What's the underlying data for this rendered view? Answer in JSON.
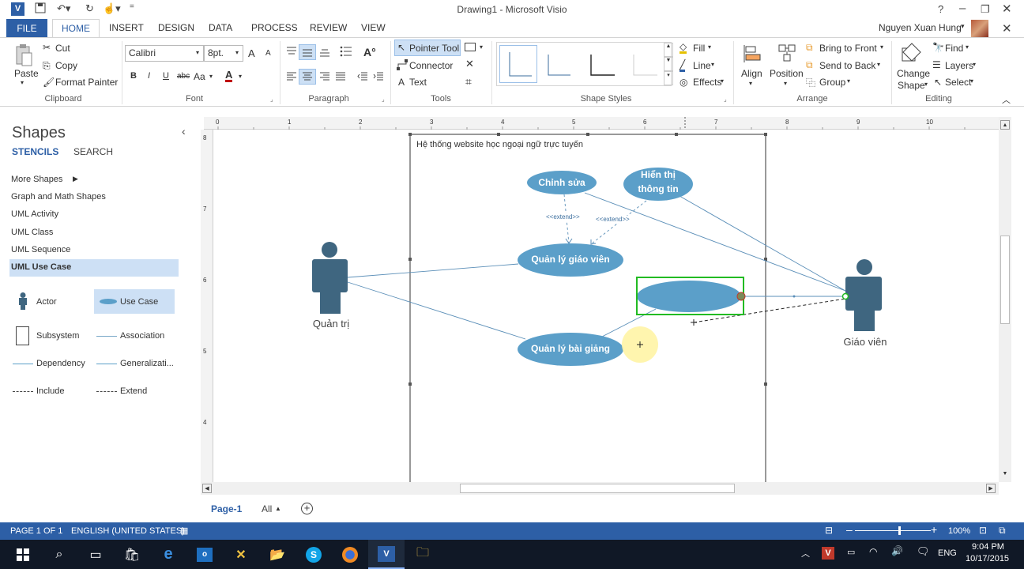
{
  "app": {
    "title": "Drawing1 - Microsoft Visio",
    "user": "Nguyen Xuan Hung",
    "help": "?",
    "logo": "V"
  },
  "tabs": [
    "FILE",
    "HOME",
    "INSERT",
    "DESIGN",
    "DATA",
    "PROCESS",
    "REVIEW",
    "VIEW"
  ],
  "ribbon": {
    "clipboard": {
      "paste": "Paste",
      "cut": "Cut",
      "copy": "Copy",
      "format_painter": "Format Painter",
      "label": "Clipboard"
    },
    "font": {
      "family": "Calibri",
      "size": "8pt.",
      "grow": "A",
      "shrink": "A",
      "bold": "B",
      "italic": "I",
      "underline": "U",
      "strike": "abc",
      "case": "Aa",
      "color": "A",
      "label": "Font"
    },
    "paragraph": {
      "label": "Paragraph"
    },
    "tools": {
      "pointer": "Pointer Tool",
      "connector": "Connector",
      "text": "Text",
      "label": "Tools"
    },
    "shape_styles": {
      "fill": "Fill",
      "line": "Line",
      "effects": "Effects",
      "label": "Shape Styles"
    },
    "arrange": {
      "align": "Align",
      "position": "Position",
      "bring_front": "Bring to Front",
      "send_back": "Send to Back",
      "group": "Group",
      "label": "Arrange"
    },
    "editing": {
      "change_shape_1": "Change",
      "change_shape_2": "Shape",
      "find": "Find",
      "layers": "Layers",
      "select": "Select",
      "label": "Editing"
    }
  },
  "shapes_pane": {
    "title": "Shapes",
    "tab_stencils": "STENCILS",
    "tab_search": "SEARCH",
    "stencils": [
      "More Shapes",
      "Graph and Math Shapes",
      "UML Activity",
      "UML Class",
      "UML Sequence",
      "UML Use Case"
    ],
    "masters": [
      {
        "name": "Actor",
        "icon": "actor-icon"
      },
      {
        "name": "Use Case",
        "icon": "use-case-icon"
      },
      {
        "name": "Subsystem",
        "icon": "subsystem-icon"
      },
      {
        "name": "Association",
        "icon": "association-icon"
      },
      {
        "name": "Dependency",
        "icon": "dependency-icon"
      },
      {
        "name": "Generalizati...",
        "icon": "generalization-icon"
      },
      {
        "name": "Include",
        "icon": "include-icon"
      },
      {
        "name": "Extend",
        "icon": "extend-icon"
      }
    ]
  },
  "ruler": {
    "top": [
      "0",
      "1",
      "2",
      "3",
      "4",
      "5",
      "6",
      "7",
      "8",
      "9",
      "10"
    ],
    "left": [
      "8",
      "7",
      "6",
      "5",
      "4"
    ]
  },
  "diagram": {
    "system_title": "Hệ thống website học ngoại ngữ trực tuyến",
    "actor_admin": "Quản trị",
    "actor_teacher": "Giáo viên",
    "uc_edit": "Chỉnh sửa",
    "uc_show_1": "Hiển thị",
    "uc_show_2": "thông tin",
    "uc_manage_teacher": "Quản lý giáo viên",
    "uc_manage_lecture": "Quản lý bài giảng",
    "extend_1": "<<extend>>",
    "extend_2": "<<extend>>"
  },
  "pages": {
    "current": "Page-1",
    "all": "All"
  },
  "status": {
    "page": "PAGE 1 OF 1",
    "language": "ENGLISH (UNITED STATES)",
    "zoom": "100%",
    "zoom_level": 0.57
  },
  "taskbar": {
    "lang": "ENG",
    "time": "9:04 PM",
    "date": "10/17/2015"
  },
  "colors": {
    "accent": "#2d5fa6",
    "usecase": "#5b9fc9",
    "actor": "#3f6680",
    "selection": "#22bb22"
  }
}
